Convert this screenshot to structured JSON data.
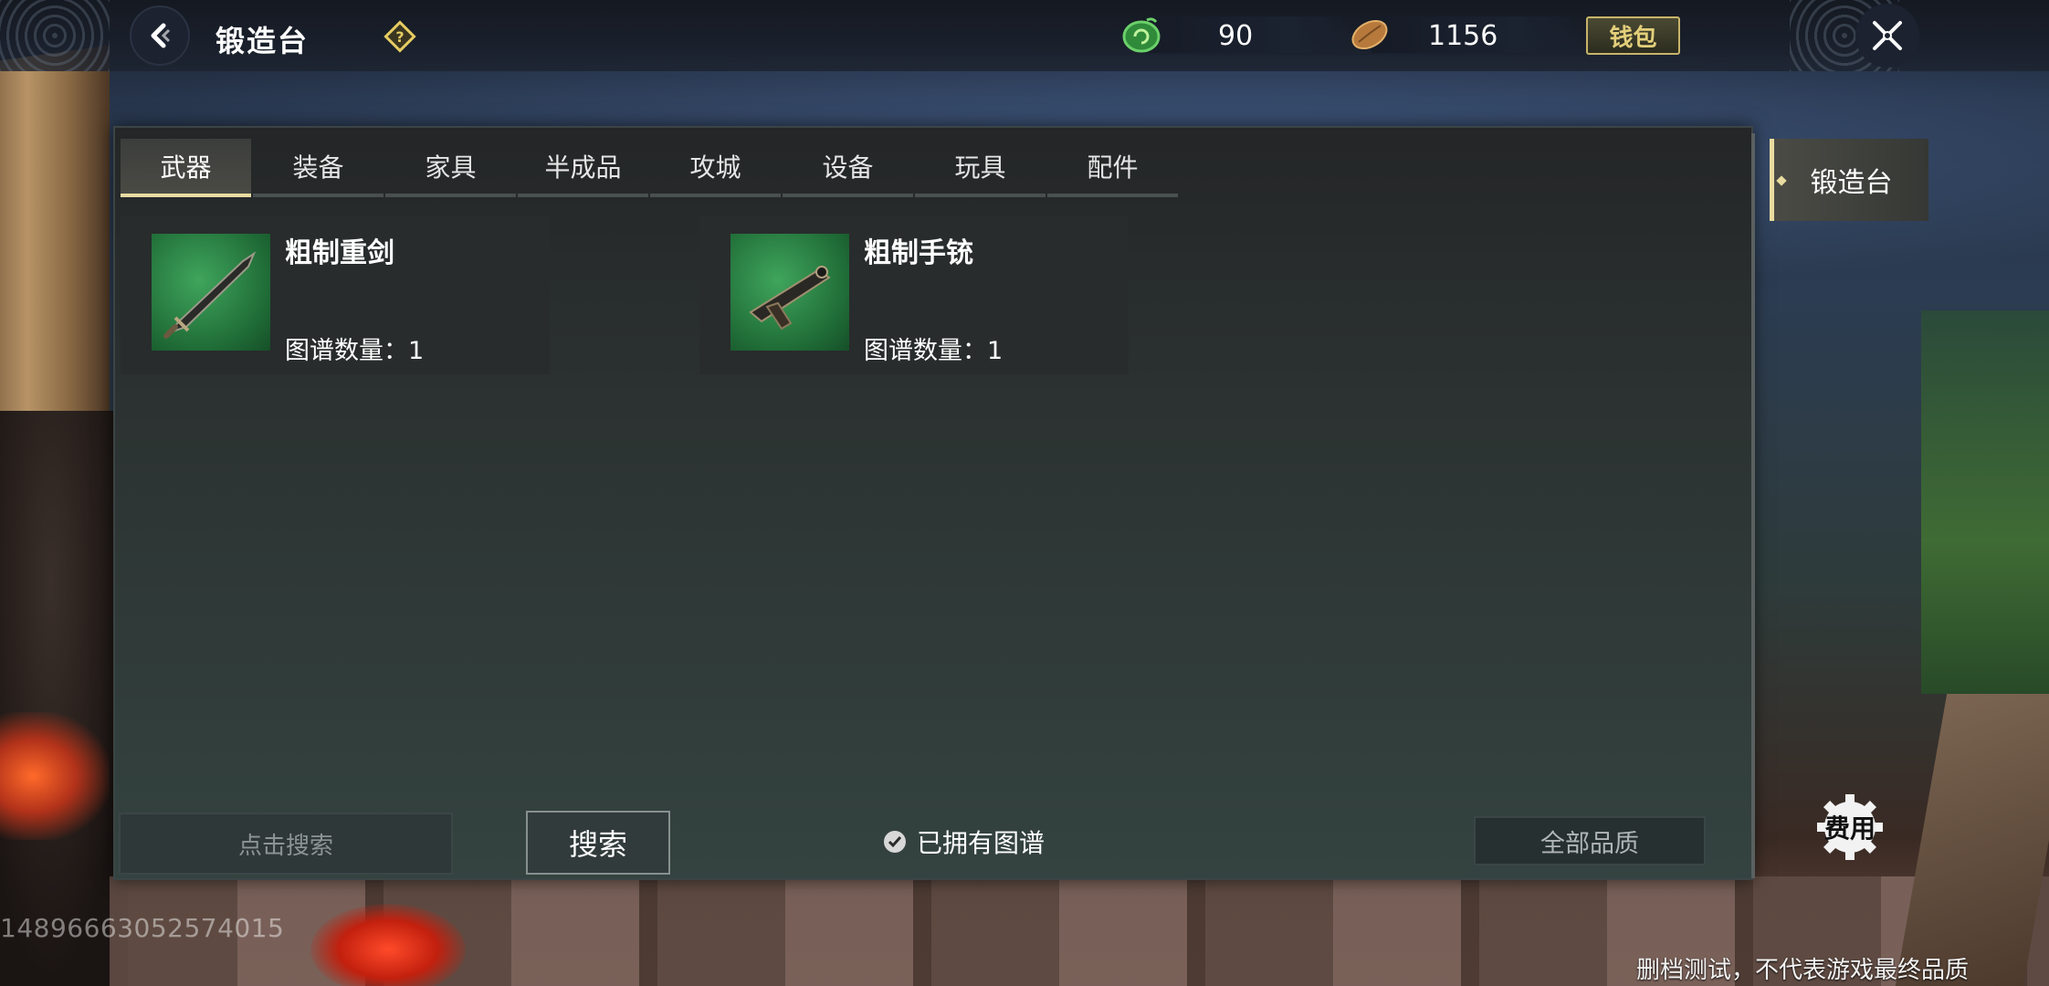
{
  "header": {
    "title": "锻造台",
    "currency_primary": {
      "icon": "green-spiral-icon",
      "value": "90"
    },
    "currency_secondary": {
      "icon": "seed-icon",
      "value": "1156"
    },
    "wallet_label": "钱包"
  },
  "tabs": [
    {
      "label": "武器",
      "active": true
    },
    {
      "label": "装备",
      "active": false
    },
    {
      "label": "家具",
      "active": false
    },
    {
      "label": "半成品",
      "active": false
    },
    {
      "label": "攻城",
      "active": false
    },
    {
      "label": "设备",
      "active": false
    },
    {
      "label": "玩具",
      "active": false
    },
    {
      "label": "配件",
      "active": false
    }
  ],
  "items": [
    {
      "name": "粗制重剑",
      "count_label": "图谱数量：",
      "count": "1"
    },
    {
      "name": "粗制手铳",
      "count_label": "图谱数量：",
      "count": "1"
    }
  ],
  "bottom": {
    "search_placeholder": "点击搜索",
    "search_button": "搜索",
    "owned_label": "已拥有图谱",
    "owned_checked": true,
    "quality_label": "全部品质"
  },
  "side": {
    "station_label": "锻造台",
    "fee_label": "费用"
  },
  "footer": {
    "uid": "1489666305257401​5",
    "note": "删档测试，不代表游戏最终品质"
  },
  "colors": {
    "accent_gold": "#e9dca0",
    "panel_bg": "#2c3332",
    "item_bg_green": "#2f8a48"
  }
}
